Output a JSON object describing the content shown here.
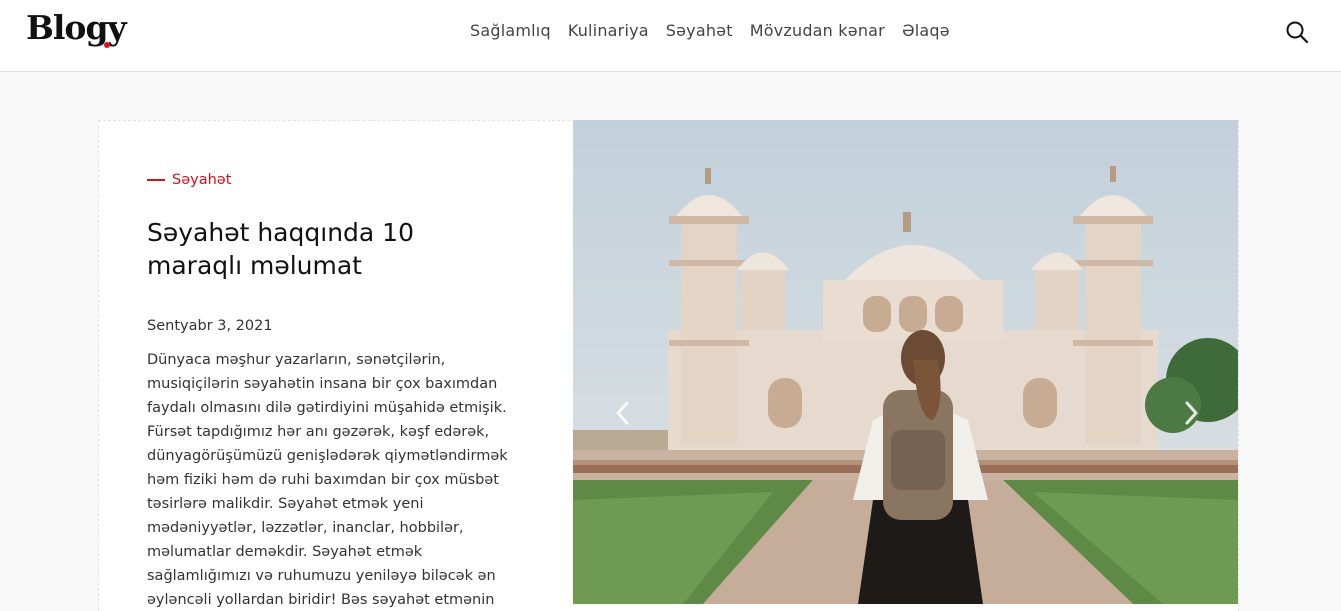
{
  "header": {
    "logo": "Blogy",
    "nav": [
      "Sağlamlıq",
      "Kulinariya",
      "Səyahət",
      "Mövzudan kənar",
      "Əlaqə"
    ]
  },
  "post": {
    "category": "Səyahət",
    "title": "Səyahət haqqında 10 maraqlı məlumat",
    "date": "Sentyabr 3, 2021",
    "excerpt": "Dünyaca məşhur yazarların, sənətçilərin, musiqiçilərin səyahətin insana bir çox baxımdan faydalı olmasını dilə gətirdiyini müşahidə etmişik. Fürsət tapdığımız hər anı gəzərək, kəşf edərək, dünyagörüşümüzü genişlədərək qiymətləndirmək həm fiziki həm də ruhi baxımdan bir çox müsbət təsirlərə malikdir. Səyahət etmək yeni mədəniyyətlər, ləzzətlər, inanclar, hobbilər, məlumatlar deməkdir. Səyahət etmək sağlamlığımızı və ruhumuzu yeniləyə biləcək ən əyləncəli yollardan biridir! Bəs səyahət etmənin"
  },
  "colors": {
    "accent": "#d7101e",
    "logo_dot": "#e0102a"
  },
  "icons": {
    "search": "search-icon",
    "prev": "chevron-left-icon",
    "next": "chevron-right-icon"
  }
}
